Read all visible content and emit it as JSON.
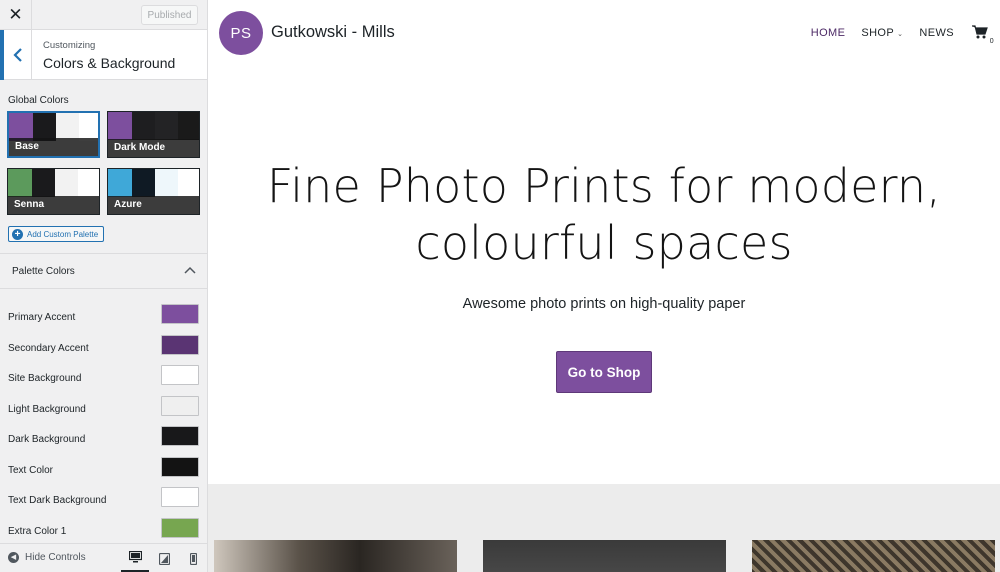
{
  "sidebar": {
    "close_glyph": "✕",
    "published_label": "Published",
    "section": {
      "subtitle": "Customizing",
      "title": "Colors & Background"
    },
    "global_colors_label": "Global Colors",
    "palettes": [
      {
        "name": "Base",
        "selected": true
      },
      {
        "name": "Dark Mode",
        "selected": false
      },
      {
        "name": "Senna",
        "selected": false
      },
      {
        "name": "Azure",
        "selected": false
      }
    ],
    "add_palette_label": "Add Custom Palette",
    "palette_colors_label": "Palette Colors",
    "colors": [
      {
        "label": "Primary Accent",
        "color": "#7d4f9e"
      },
      {
        "label": "Secondary Accent",
        "color": "#5a3473"
      },
      {
        "label": "Site Background",
        "color": "#ffffff"
      },
      {
        "label": "Light Background",
        "color": "#efefef"
      },
      {
        "label": "Dark Background",
        "color": "#18181a"
      },
      {
        "label": "Text Color",
        "color": "#131313"
      },
      {
        "label": "Text Dark Background",
        "color": "#ffffff"
      },
      {
        "label": "Extra Color 1",
        "color": "#77a650"
      }
    ],
    "footer": {
      "hide_controls_label": "Hide Controls",
      "devices": [
        "desktop-icon",
        "tablet-icon",
        "mobile-icon"
      ]
    }
  },
  "preview": {
    "logo_initials": "PS",
    "site_name": "Gutkowski - Mills",
    "nav": {
      "home": "HOME",
      "shop": "SHOP",
      "news": "NEWS",
      "cart_count": "0"
    },
    "hero": {
      "title_line1": "Fine Photo Prints for modern,",
      "title_line2": "colourful spaces",
      "subtitle": "Awesome photo prints on high-quality paper",
      "button": "Go to Shop"
    }
  },
  "colors": {
    "accent": "#7d4f9e",
    "wp_blue": "#2271b1",
    "sidebar_bg": "#f0f0f1"
  }
}
